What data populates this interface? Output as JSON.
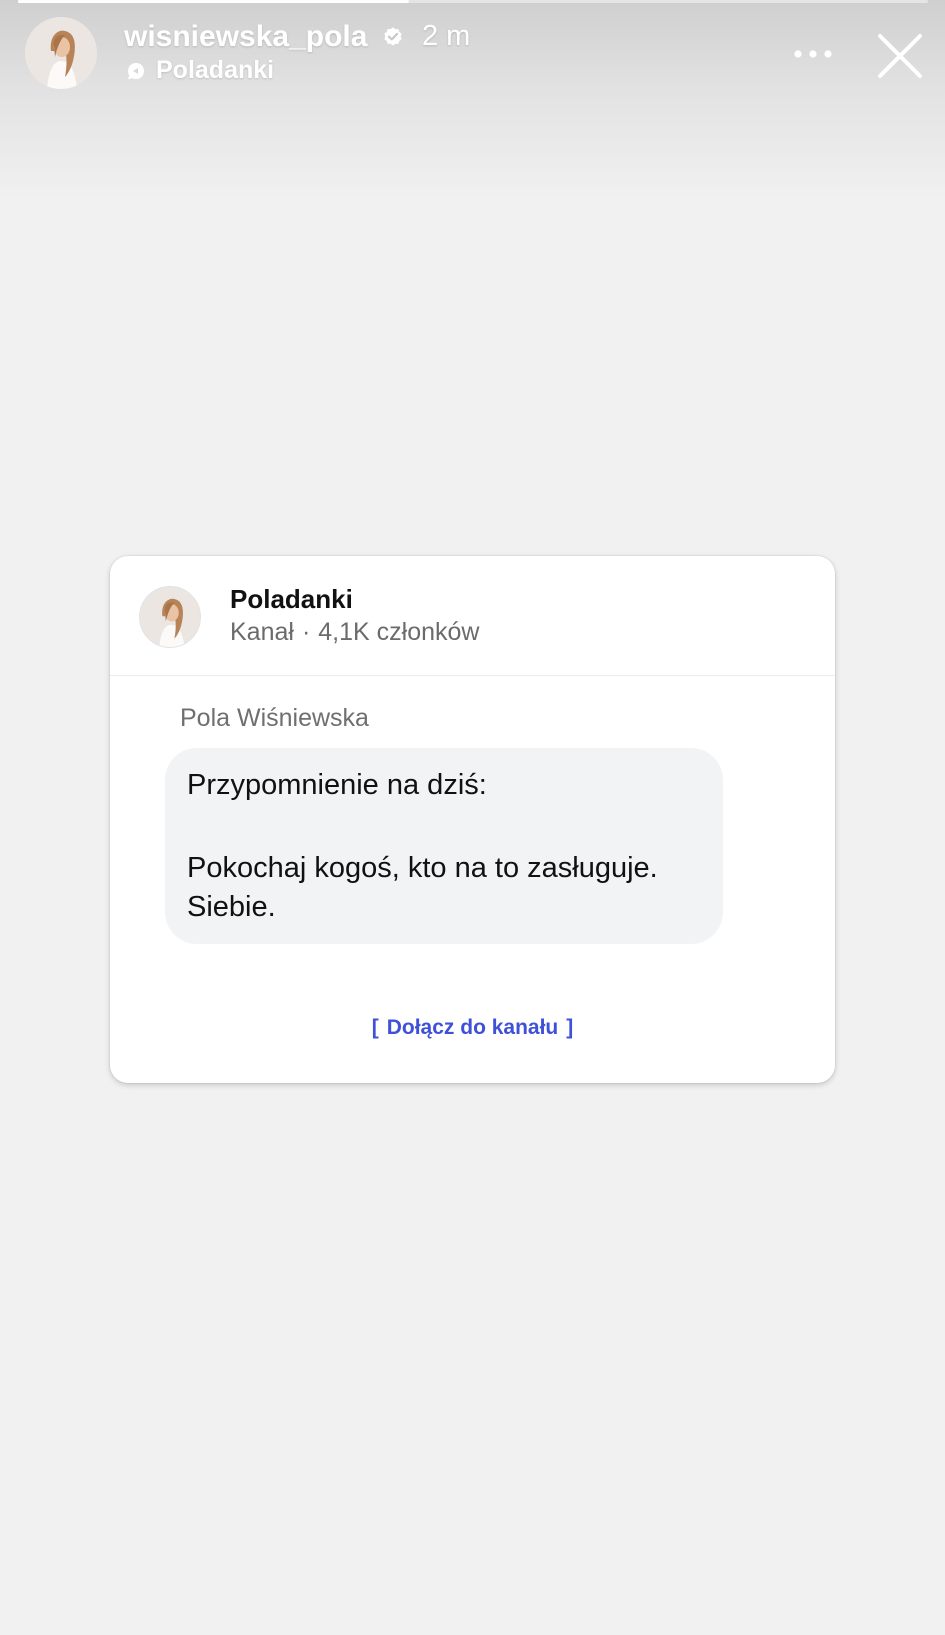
{
  "story": {
    "progress": 0.43,
    "username": "wisniewska_pola",
    "time": "2 m",
    "channel_label": "Poladanki",
    "icons": {
      "verified": "verified-badge-icon",
      "channel": "channel-icon",
      "more": "more-options-icon",
      "close": "close-icon"
    }
  },
  "card": {
    "channel_name": "Poladanki",
    "channel_type": "Kanał",
    "separator": "·",
    "members": "4,1K członków",
    "sender": "Pola Wiśniewska",
    "message_line1": "Przypomnienie na dziś:",
    "message_line2": "Pokochaj kogoś, kto na to zasługuje.",
    "message_line3": "Siebie.",
    "join_label": "Dołącz do kanału",
    "accent_color": "#3f51d8"
  }
}
